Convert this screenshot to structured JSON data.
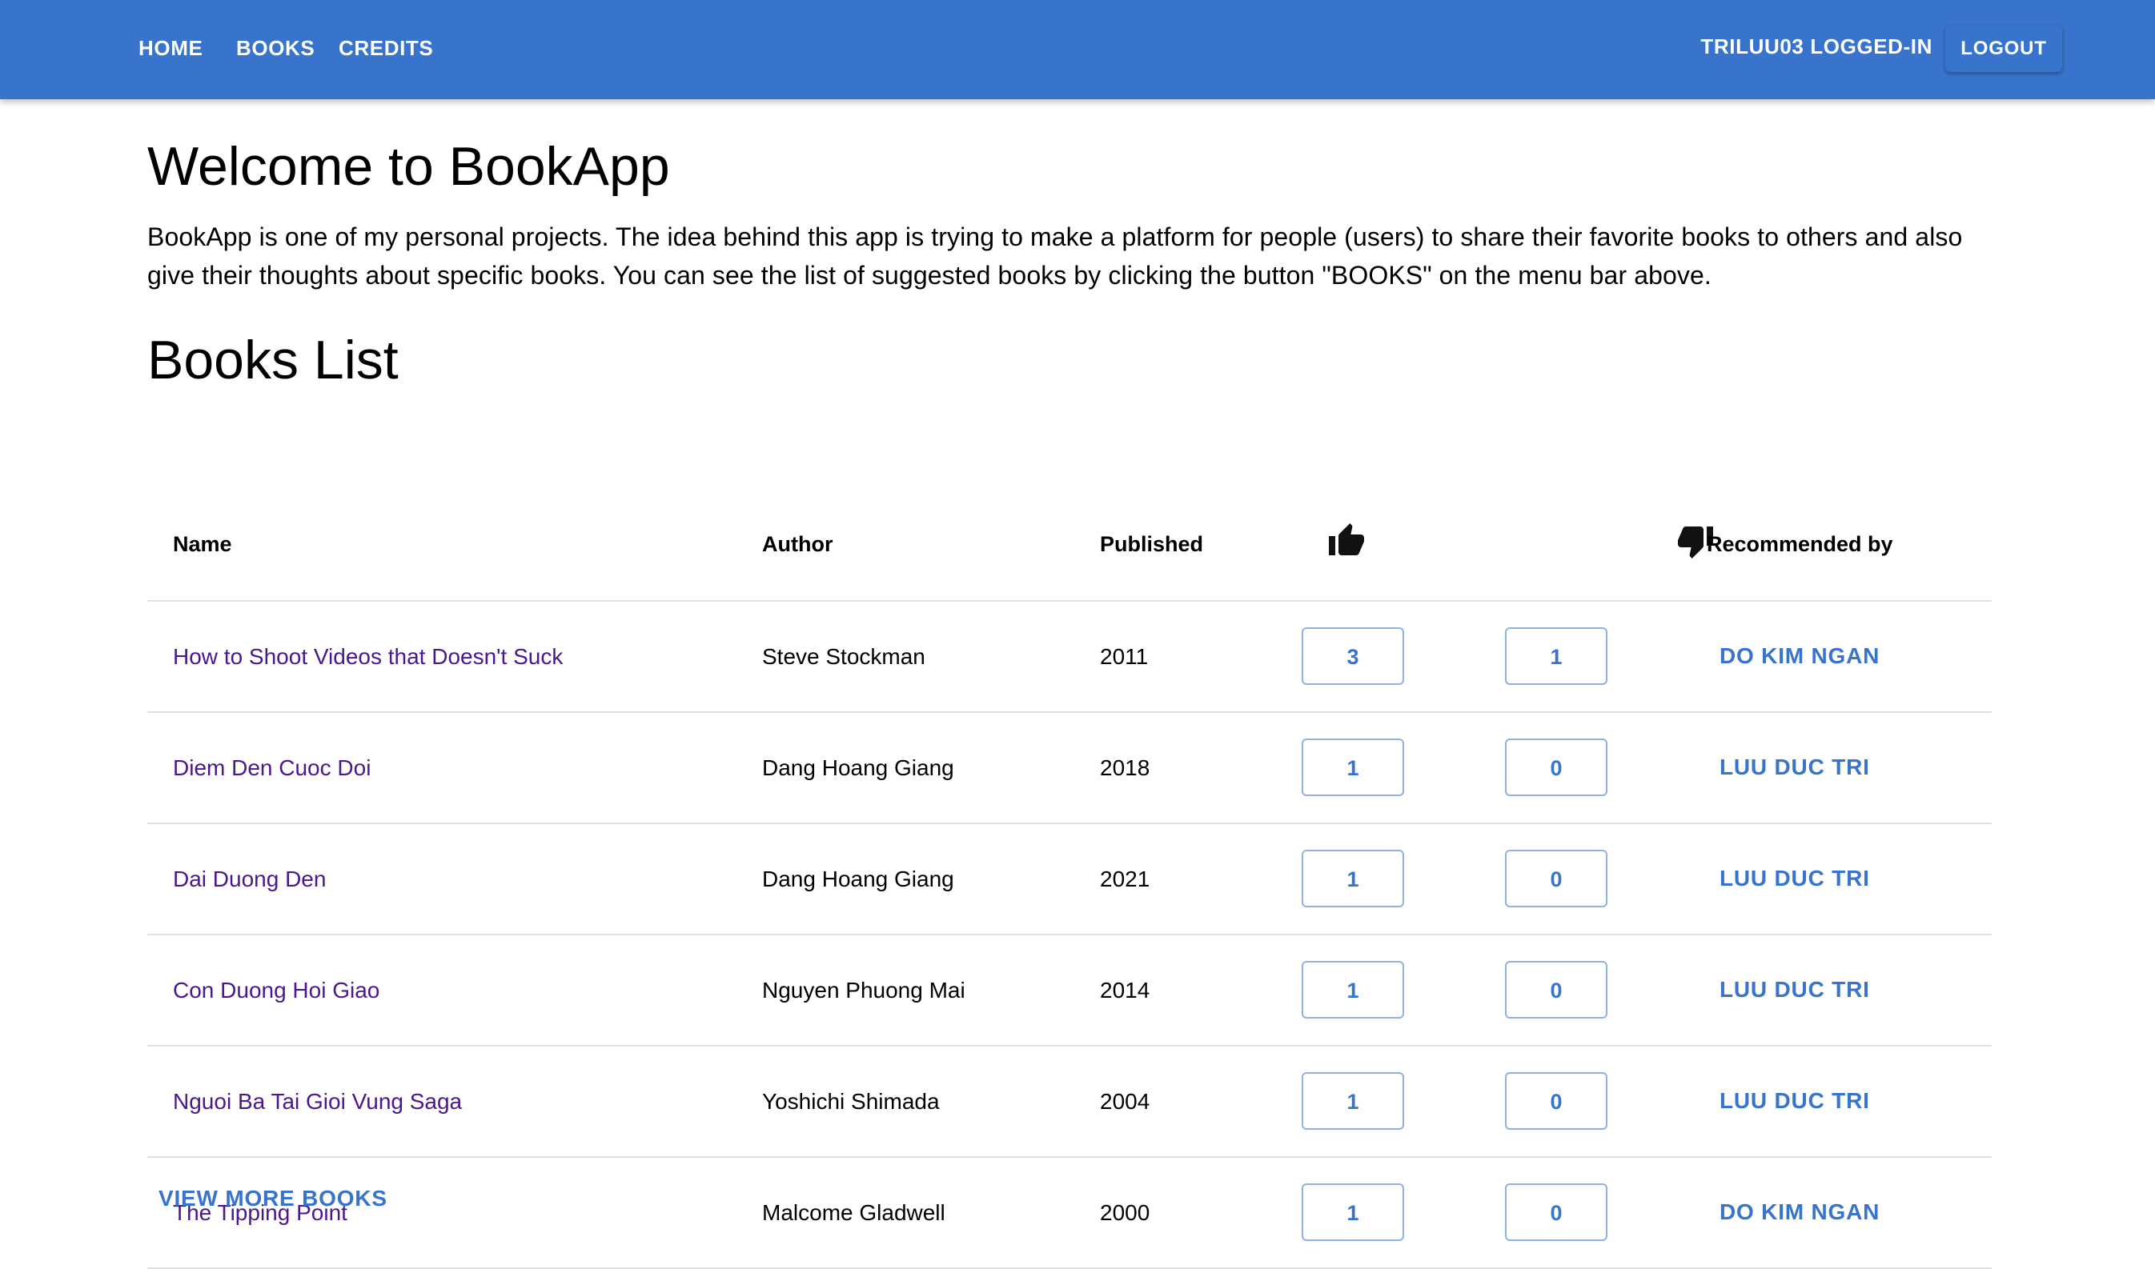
{
  "nav": {
    "home": "HOME",
    "books": "BOOKS",
    "credits": "CREDITS",
    "user_status": "TRILUU03 LOGGED-IN",
    "logout": "LOGOUT"
  },
  "welcome": {
    "title": "Welcome to BookApp",
    "intro": "BookApp is one of my personal projects. The idea behind this app is trying to make a platform for people (users) to share their favorite books to others and also give their thoughts about specific books. You can see the list of suggested books by clicking the button \"BOOKS\" on the menu bar above."
  },
  "books": {
    "title": "Books List",
    "headers": {
      "name": "Name",
      "author": "Author",
      "published": "Published",
      "likes_icon": "thumb-up-icon",
      "dislikes_icon": "thumb-down-icon",
      "recommended_by": "Recommended by"
    },
    "rows": [
      {
        "name": "How to Shoot Videos that Doesn't Suck",
        "author": "Steve Stockman",
        "published": "2011",
        "likes": "3",
        "dislikes": "1",
        "recommended_by": "DO KIM NGAN"
      },
      {
        "name": "Diem Den Cuoc Doi",
        "author": "Dang Hoang Giang",
        "published": "2018",
        "likes": "1",
        "dislikes": "0",
        "recommended_by": "LUU DUC TRI"
      },
      {
        "name": "Dai Duong Den",
        "author": "Dang Hoang Giang",
        "published": "2021",
        "likes": "1",
        "dislikes": "0",
        "recommended_by": "LUU DUC TRI"
      },
      {
        "name": "Con Duong Hoi Giao",
        "author": "Nguyen Phuong Mai",
        "published": "2014",
        "likes": "1",
        "dislikes": "0",
        "recommended_by": "LUU DUC TRI"
      },
      {
        "name": "Nguoi Ba Tai Gioi Vung Saga",
        "author": "Yoshichi Shimada",
        "published": "2004",
        "likes": "1",
        "dislikes": "0",
        "recommended_by": "LUU DUC TRI"
      },
      {
        "name": "The Tipping Point",
        "author": "Malcome Gladwell",
        "published": "2000",
        "likes": "1",
        "dislikes": "0",
        "recommended_by": "DO KIM NGAN"
      }
    ],
    "view_more": "VIEW MORE BOOKS"
  },
  "colors": {
    "appbar": "#3874cb",
    "accent": "#3874cb",
    "book_link": "#4a1790",
    "outline": "#8fb1e4",
    "divider": "#e0e0e0"
  }
}
